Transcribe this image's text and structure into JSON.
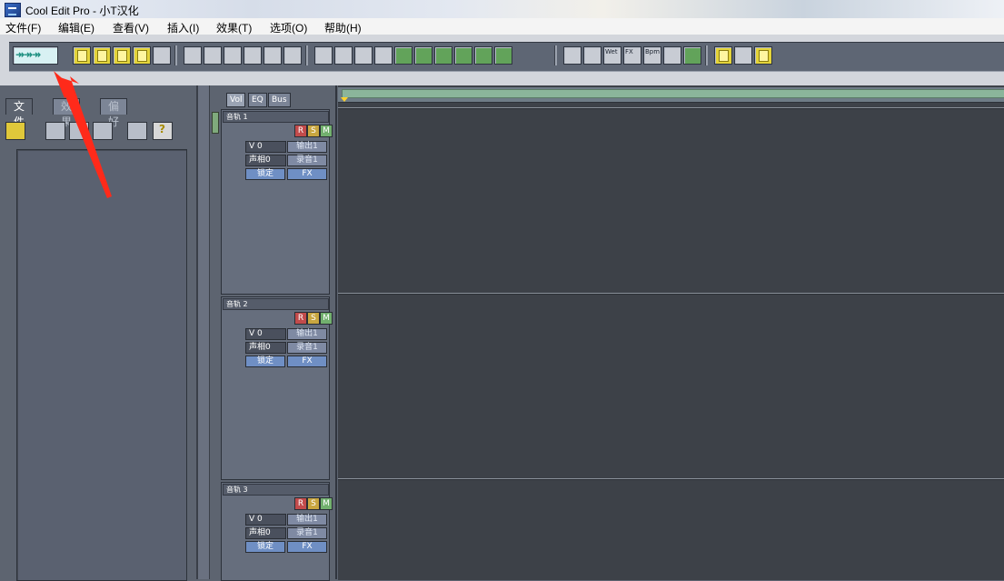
{
  "window": {
    "title": "Cool Edit Pro  - 小T汉化"
  },
  "menu": [
    "文件(F)",
    "编辑(E)",
    "查看(V)",
    "插入(I)",
    "效果(T)",
    "选项(O)",
    "帮助(H)"
  ],
  "toolbar": {
    "switch_label": "↠↠↠",
    "fx_labels": [
      "Wet",
      "FX",
      "Bpm"
    ]
  },
  "file_panel": {
    "tabs": [
      "文件",
      "效果",
      "偏好"
    ]
  },
  "track_panel": {
    "view_tabs": [
      "Vol",
      "EQ",
      "Bus"
    ],
    "tracks": [
      {
        "name": "音轨 1",
        "r": "R",
        "s": "S",
        "m": "M",
        "volume": "V 0",
        "out": "输出1",
        "pan": "声相0",
        "rec": "录音1",
        "lock": "锁定",
        "fx": "FX"
      },
      {
        "name": "音轨 2",
        "r": "R",
        "s": "S",
        "m": "M",
        "volume": "V 0",
        "out": "输出1",
        "pan": "声相0",
        "rec": "录音1",
        "lock": "锁定",
        "fx": "FX"
      },
      {
        "name": "音轨 3",
        "r": "R",
        "s": "S",
        "m": "M",
        "volume": "V 0",
        "out": "输出1",
        "pan": "声相0",
        "rec": "录音1",
        "lock": "锁定",
        "fx": "FX"
      }
    ]
  },
  "colors": {
    "annotation_arrow": "#ff2a1a",
    "panel": "#5d6470",
    "wave_bg": "#3e4249"
  }
}
